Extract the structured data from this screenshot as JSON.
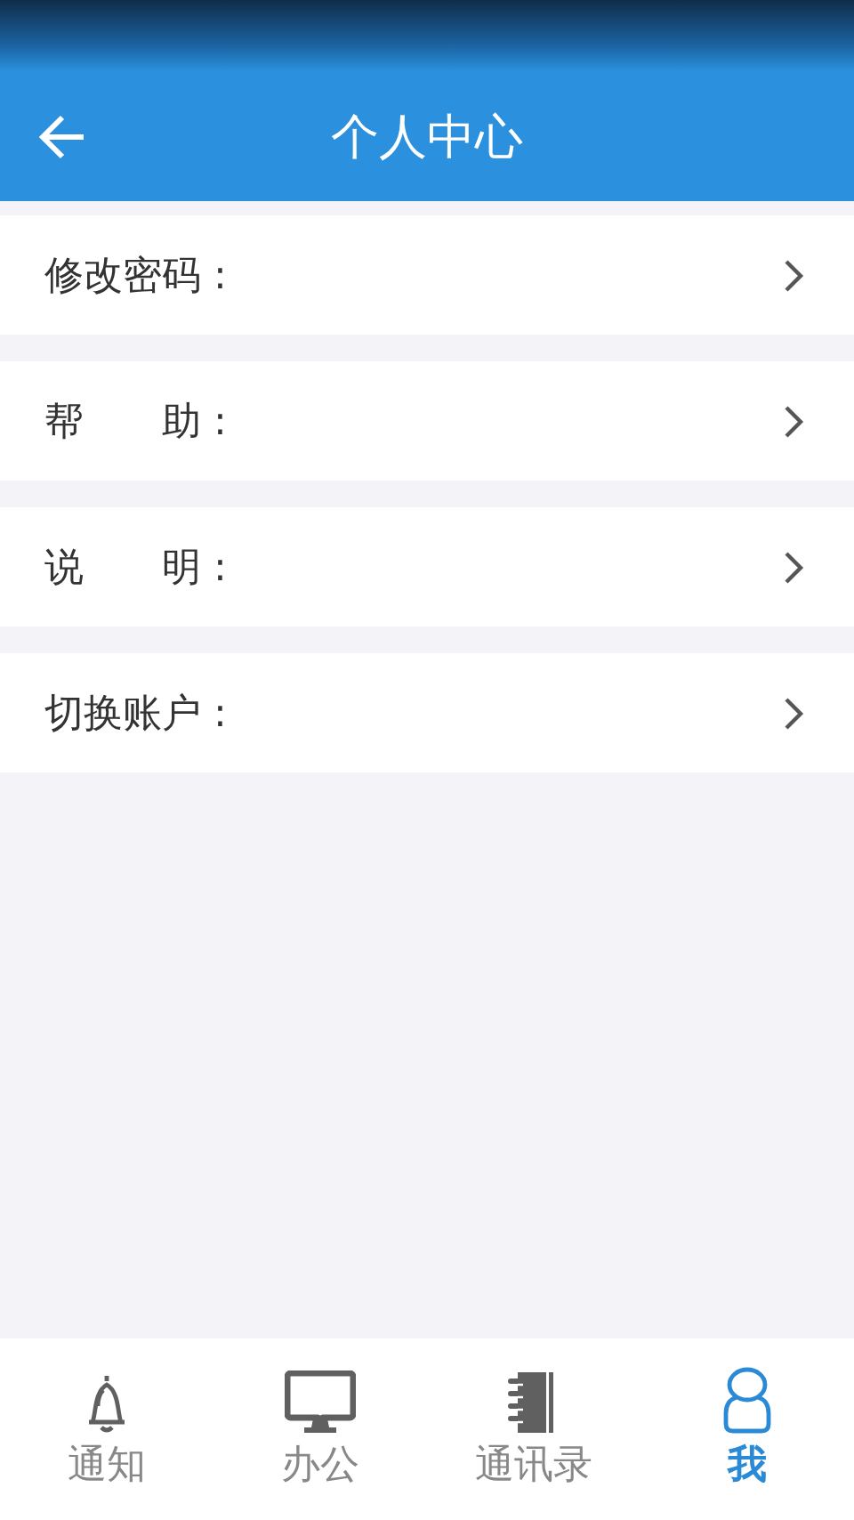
{
  "header": {
    "title": "个人中心"
  },
  "menu": [
    {
      "label": "修改密码 :"
    },
    {
      "label": "帮　　助 :"
    },
    {
      "label": "说　　明 :"
    },
    {
      "label": "切换账户 :"
    }
  ],
  "tabs": [
    {
      "label": "通知",
      "selected": false
    },
    {
      "label": "办公",
      "selected": false
    },
    {
      "label": "通讯录",
      "selected": false
    },
    {
      "label": "我",
      "selected": true
    }
  ]
}
